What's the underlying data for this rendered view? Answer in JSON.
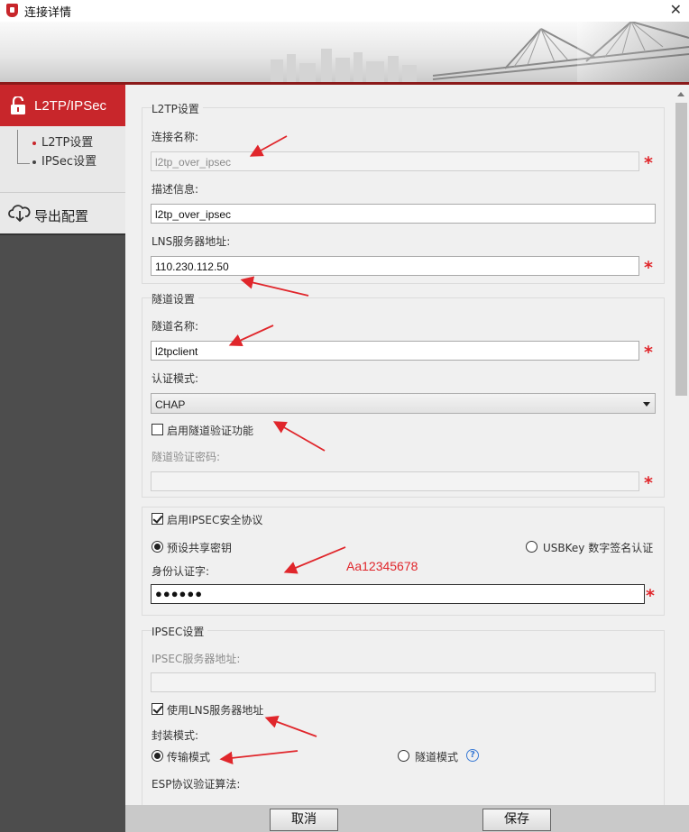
{
  "window": {
    "title": "连接详情",
    "close_glyph": "✕"
  },
  "sidebar": {
    "l2tp_label": "L2TP/IPSec",
    "sub_items": [
      {
        "label": "L2TP设置",
        "active": true
      },
      {
        "label": "IPSec设置",
        "active": false
      }
    ],
    "export_label": "导出配置"
  },
  "l2tp": {
    "legend": "L2TP设置",
    "conn_name_label": "连接名称:",
    "conn_name_value": "l2tp_over_ipsec",
    "desc_label": "描述信息:",
    "desc_value": "l2tp_over_ipsec",
    "lns_label": "LNS服务器地址:",
    "lns_value": "110.230.112.50"
  },
  "tunnel": {
    "legend": "隧道设置",
    "name_label": "隧道名称:",
    "name_value": "l2tpclient",
    "auth_label": "认证模式:",
    "auth_value": "CHAP",
    "enable_verify_label": "启用隧道验证功能",
    "enable_verify_checked": false,
    "verify_pwd_label": "隧道验证密码:",
    "verify_pwd_value": ""
  },
  "ipsec_proto": {
    "enable_label": "启用IPSEC安全协议",
    "enable_checked": true,
    "psk_label": "预设共享密钥",
    "psk_selected": true,
    "usbkey_label": "USBKey 数字签名认证",
    "identity_label": "身份认证字:",
    "identity_value": "●●●●●●"
  },
  "ipsec": {
    "legend": "IPSEC设置",
    "server_label": "IPSEC服务器地址:",
    "server_value": "",
    "use_lns_label": "使用LNS服务器地址",
    "use_lns_checked": true,
    "encap_label": "封装模式:",
    "transport_label": "传输模式",
    "transport_selected": true,
    "tunnel_mode_label": "隧道模式",
    "help_glyph": "?",
    "esp_label": "ESP协议验证算法:"
  },
  "annotation": {
    "password_hint": "Aa12345678"
  },
  "required_mark": "*",
  "buttons": {
    "cancel": "取消",
    "save": "保存"
  },
  "colors": {
    "accent": "#c8262b",
    "required": "#e0262b",
    "sidebar_bg": "#4d4d4d"
  },
  "icons": {
    "app": "shield-icon",
    "lock": "unlock-icon",
    "export": "cloud-download-icon",
    "help": "question-icon"
  }
}
